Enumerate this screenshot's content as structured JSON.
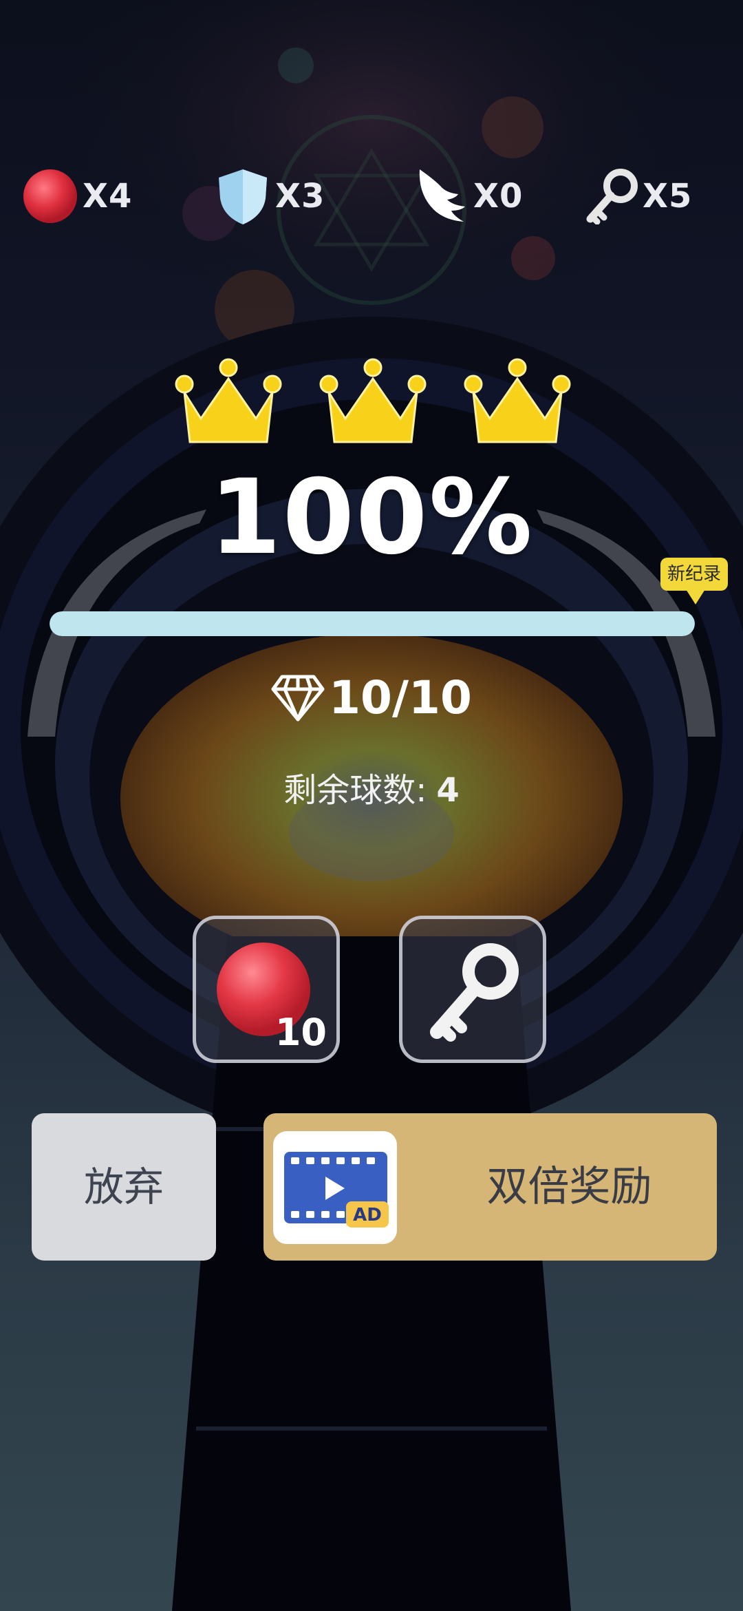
{
  "resources": [
    {
      "icon": "red-ball-icon",
      "count": "X4"
    },
    {
      "icon": "shield-icon",
      "count": "X3"
    },
    {
      "icon": "wing-icon",
      "count": "X0"
    },
    {
      "icon": "key-icon",
      "count": "X5"
    }
  ],
  "result": {
    "crowns": 3,
    "percent_text": "100%",
    "progress": 1.0,
    "new_record_badge": "新纪录",
    "gems_text": "10/10",
    "remaining_label": "剩余球数:",
    "remaining_value": "4"
  },
  "items": {
    "ball_count": "10"
  },
  "buttons": {
    "give_up": "放弃",
    "double_reward": "双倍奖励",
    "ad_label": "AD"
  },
  "colors": {
    "crown": "#f8d21a",
    "progress_fill": "#bfe5ee",
    "badge": "#f3d83a",
    "double_button": "#d6b676",
    "give_up_button": "#d8dade"
  }
}
